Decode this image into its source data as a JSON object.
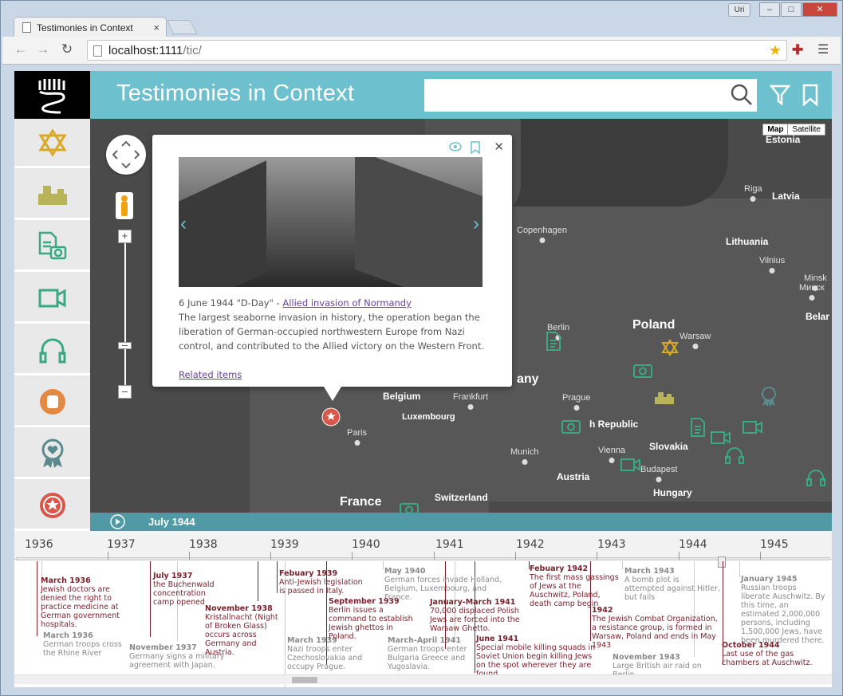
{
  "browser": {
    "tab_title": "Testimonies in Context",
    "user": "Uri",
    "url_host": "localhost:1111",
    "url_path": "/tic/",
    "win_min": "–",
    "win_max": "□",
    "win_close": "✕"
  },
  "header": {
    "title": "Testimonies in Context",
    "search_placeholder": ""
  },
  "sidebar": {
    "items": [
      "star-of-david",
      "ghetto",
      "documents",
      "video",
      "audio",
      "resistance",
      "remembrance",
      "military"
    ]
  },
  "map": {
    "types": [
      "Map",
      "Satellite"
    ],
    "countries": [
      {
        "name": "Estonia"
      },
      {
        "name": "Latvia"
      },
      {
        "name": "Lithuania"
      },
      {
        "name": "Poland"
      },
      {
        "name": "Belar"
      },
      {
        "name": "Belgium"
      },
      {
        "name": "Luxembourg"
      },
      {
        "name": "France"
      },
      {
        "name": "Switzerland"
      },
      {
        "name": "Austria"
      },
      {
        "name": "Hungary"
      },
      {
        "name": "Slovakia"
      },
      {
        "name": "h Republic"
      },
      {
        "name": "any"
      }
    ],
    "cities": [
      "Riga",
      "Copenhagen",
      "Vilnius",
      "Minsk",
      "Минск",
      "Berlin",
      "Warsaw",
      "Frankfurt",
      "Prague",
      "Paris",
      "Munich",
      "Vienna",
      "Budapest"
    ]
  },
  "popup": {
    "date": "6 June 1944 \"D-Day\" -",
    "link": "Allied invasion of Normandy",
    "body": "The largest seaborne invasion in history, the operation began the liberation of German-occupied northwestern Europe from Nazi control, and contributed to the Allied victory on the Western Front.",
    "related": "Related items",
    "close": "✕",
    "prev": "‹",
    "next": "›"
  },
  "playbar": {
    "date": "July 1944"
  },
  "timeline": {
    "years": [
      "1936",
      "1937",
      "1938",
      "1939",
      "1940",
      "1941",
      "1942",
      "1943",
      "1944",
      "1945"
    ],
    "events": [
      {
        "d": "March 1936",
        "t": "Jewish doctors are denied the right to practice medicine at German government hospitals.",
        "c": "r"
      },
      {
        "d": "March 1936",
        "t": "German troops cross the Rhine River",
        "c": "g"
      },
      {
        "d": "July 1937",
        "t": "the Buchenwald concentration camp opened",
        "c": "r"
      },
      {
        "d": "November 1937",
        "t": "Germany signs a military agreement with Japan.",
        "c": "g"
      },
      {
        "d": "November 1938",
        "t": "Kristallnacht (Night of Broken Glass) occurs across Germany and Austria.",
        "c": "r"
      },
      {
        "d": "Febuary 1939",
        "t": "Anti-Jewish legislation is passed in Italy.",
        "c": "r"
      },
      {
        "d": "March 1939",
        "t": "Nazi troops enter Czechoslovakia and occupy Prague.",
        "c": "g"
      },
      {
        "d": "September 1939",
        "t": "Berlin issues a command to establish Jewish ghettos in Poland.",
        "c": "r"
      },
      {
        "d": "May 1940",
        "t": "German forces invade Holland, Belgium, Luxembourg, and France.",
        "c": "g"
      },
      {
        "d": "January-March 1941",
        "t": "70,000 displaced Polish Jews are forced into the Warsaw Ghetto.",
        "c": "r"
      },
      {
        "d": "March-April 1941",
        "t": "German troops enter Bulgaria Greece and Yugoslavia.",
        "c": "g"
      },
      {
        "d": "June 1941",
        "t": "Special mobile killing squads in Soviet Union begin killing Jews on the spot wherever they are found",
        "c": "r"
      },
      {
        "d": "Febuary 1942",
        "t": "The first mass gassings of Jews at the Auschwitz, Poland, death camp begin",
        "c": "r"
      },
      {
        "d": "1942",
        "t": "The Jewish Combat Organization, a resistance group, is formed in Warsaw, Poland and ends in May 1943",
        "c": "r"
      },
      {
        "d": "March 1943",
        "t": "A bomb plot is attempted against Hitler, but fails",
        "c": "g"
      },
      {
        "d": "November 1943",
        "t": "Large British air raid on Berlin.",
        "c": "g"
      },
      {
        "d": "January 1945",
        "t": "Russian troops liberate Auschwitz. By this time, an estimated 2,000,000 persons, including 1,500,000 Jews, have been murdered there.",
        "c": "g"
      },
      {
        "d": "October 1944",
        "t": "Last use of the gas chambers at Auschwitz.",
        "c": "r"
      }
    ]
  },
  "colors": {
    "teal": "#6dc0cd",
    "gold": "#d9a928",
    "olive": "#b9b35a",
    "green": "#3aa982",
    "orange": "#e28a43",
    "slate": "#5b8a8e",
    "red": "#d9574a"
  }
}
